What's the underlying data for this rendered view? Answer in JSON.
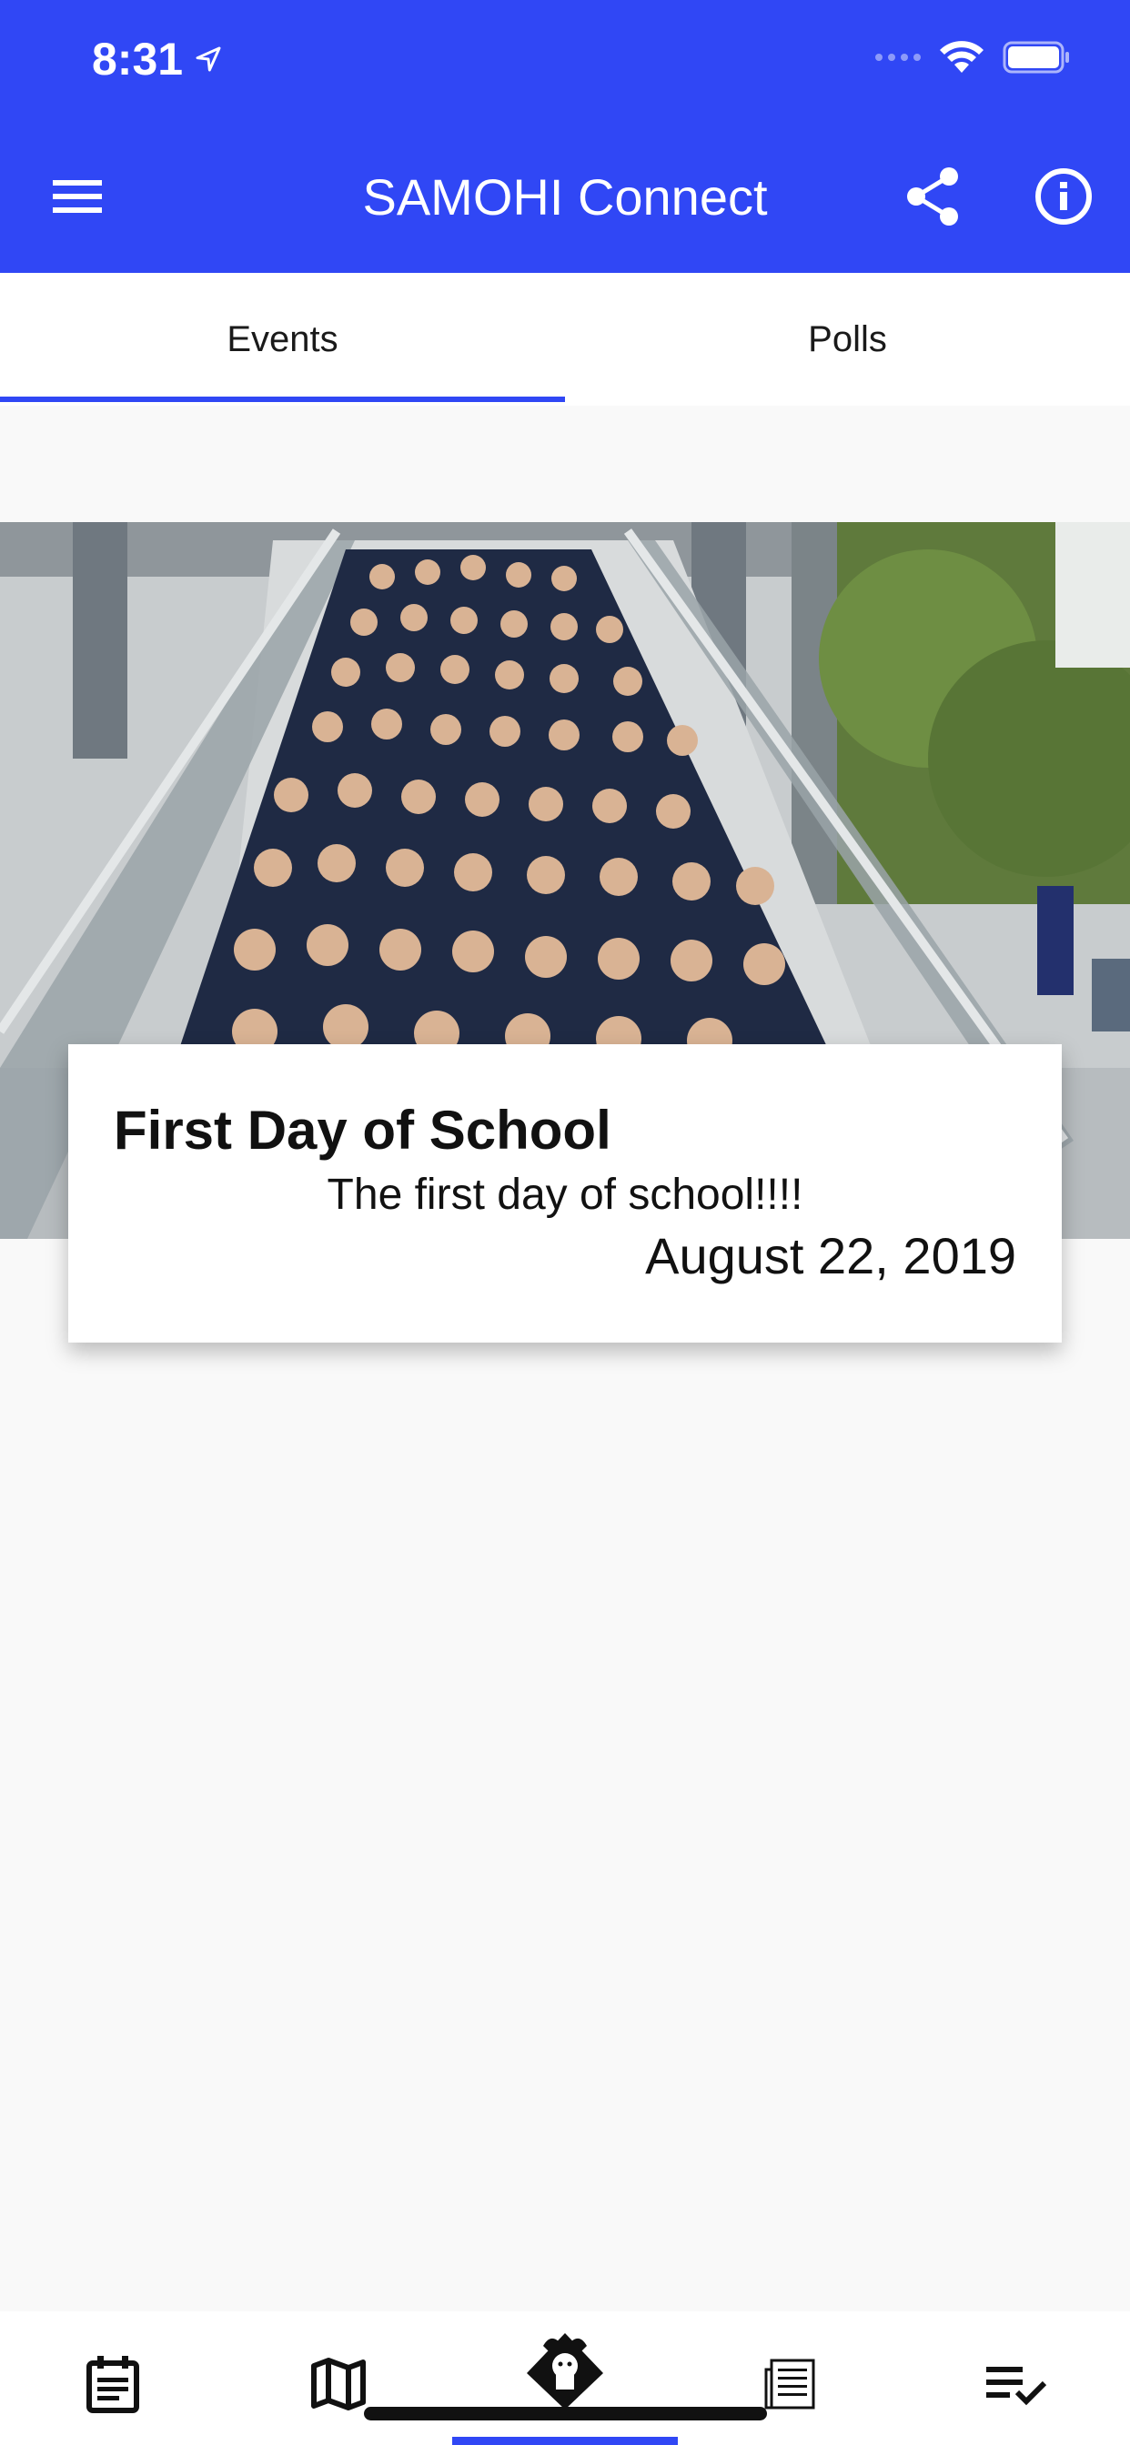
{
  "status_bar": {
    "time": "8:31"
  },
  "app_bar": {
    "title": "SAMOHI Connect",
    "color": "#3047f5"
  },
  "tabs": [
    {
      "label": "Events",
      "selected": true
    },
    {
      "label": "Polls",
      "selected": false
    }
  ],
  "event": {
    "title": "First Day of School",
    "description": "The first day of school!!!!",
    "date": "August 22, 2019"
  },
  "bottom_nav": {
    "items": [
      {
        "icon": "calendar-list-icon"
      },
      {
        "icon": "map-icon"
      },
      {
        "icon": "viking-mascot-icon",
        "selected": true
      },
      {
        "icon": "newspaper-icon"
      },
      {
        "icon": "checklist-icon"
      }
    ]
  }
}
